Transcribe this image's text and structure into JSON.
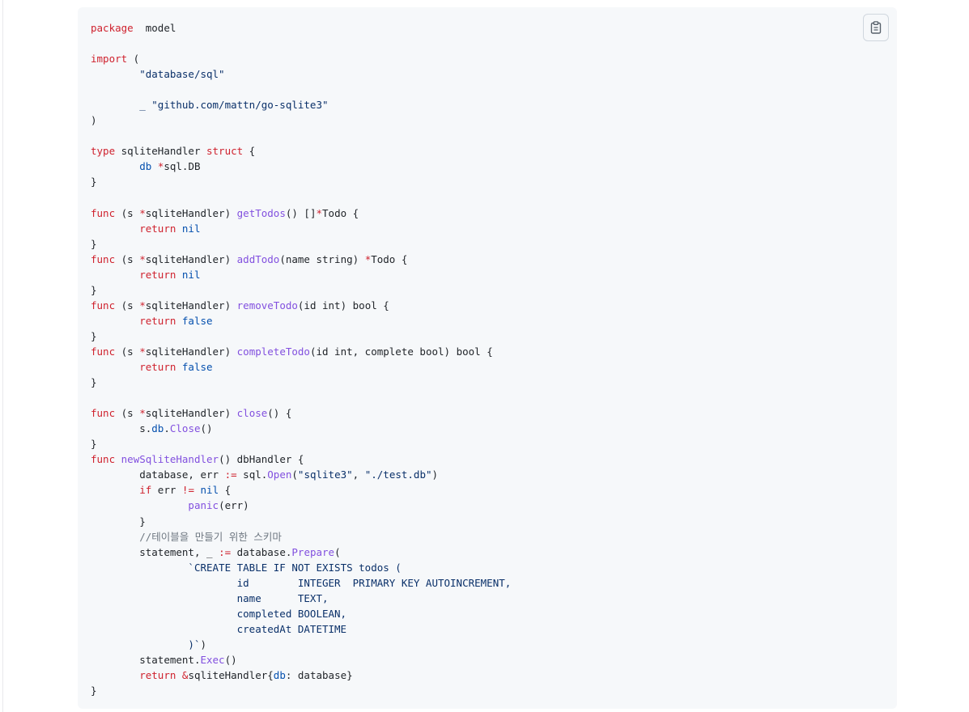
{
  "copy_button": {
    "icon": "clipboard-icon",
    "label": "Copy"
  },
  "code": {
    "language": "go",
    "lines": [
      [
        [
          "kw",
          "package"
        ],
        [
          "",
          "  model"
        ]
      ],
      [],
      [
        [
          "kw",
          "import"
        ],
        [
          "",
          " ("
        ]
      ],
      [
        [
          "st",
          "\t\"database/sql\""
        ]
      ],
      [],
      [
        [
          "st",
          "\t_ \"github.com/mattn/go-sqlite3\""
        ]
      ],
      [
        [
          "",
          ")"
        ]
      ],
      [],
      [
        [
          "kw",
          "type"
        ],
        [
          "",
          " sqliteHandler "
        ],
        [
          "kw",
          "struct"
        ],
        [
          "",
          " {"
        ]
      ],
      [
        [
          "bi",
          "\tdb"
        ],
        [
          "",
          " "
        ],
        [
          "kw",
          "*"
        ],
        [
          "",
          "sql.DB"
        ]
      ],
      [
        [
          "",
          "}"
        ]
      ],
      [],
      [
        [
          "kw",
          "func"
        ],
        [
          "",
          " (s "
        ],
        [
          "kw",
          "*"
        ],
        [
          "",
          "sqliteHandler) "
        ],
        [
          "fn",
          "getTodos"
        ],
        [
          "",
          "() []"
        ],
        [
          "kw",
          "*"
        ],
        [
          "",
          "Todo {"
        ]
      ],
      [
        [
          "kw",
          "\treturn"
        ],
        [
          "",
          " "
        ],
        [
          "bi",
          "nil"
        ]
      ],
      [
        [
          "",
          "}"
        ]
      ],
      [
        [
          "kw",
          "func"
        ],
        [
          "",
          " (s "
        ],
        [
          "kw",
          "*"
        ],
        [
          "",
          "sqliteHandler) "
        ],
        [
          "fn",
          "addTodo"
        ],
        [
          "",
          "(name string) "
        ],
        [
          "kw",
          "*"
        ],
        [
          "",
          "Todo {"
        ]
      ],
      [
        [
          "kw",
          "\treturn"
        ],
        [
          "",
          " "
        ],
        [
          "bi",
          "nil"
        ]
      ],
      [
        [
          "",
          "}"
        ]
      ],
      [
        [
          "kw",
          "func"
        ],
        [
          "",
          " (s "
        ],
        [
          "kw",
          "*"
        ],
        [
          "",
          "sqliteHandler) "
        ],
        [
          "fn",
          "removeTodo"
        ],
        [
          "",
          "(id int) bool {"
        ]
      ],
      [
        [
          "kw",
          "\treturn"
        ],
        [
          "",
          " "
        ],
        [
          "bi",
          "false"
        ]
      ],
      [
        [
          "",
          "}"
        ]
      ],
      [
        [
          "kw",
          "func"
        ],
        [
          "",
          " (s "
        ],
        [
          "kw",
          "*"
        ],
        [
          "",
          "sqliteHandler) "
        ],
        [
          "fn",
          "completeTodo"
        ],
        [
          "",
          "(id int, complete bool) bool {"
        ]
      ],
      [
        [
          "kw",
          "\treturn"
        ],
        [
          "",
          " "
        ],
        [
          "bi",
          "false"
        ]
      ],
      [
        [
          "",
          "}"
        ]
      ],
      [],
      [
        [
          "kw",
          "func"
        ],
        [
          "",
          " (s "
        ],
        [
          "kw",
          "*"
        ],
        [
          "",
          "sqliteHandler) "
        ],
        [
          "fn",
          "close"
        ],
        [
          "",
          "() {"
        ]
      ],
      [
        [
          "",
          "\ts."
        ],
        [
          "bi",
          "db"
        ],
        [
          "",
          "."
        ],
        [
          "fn",
          "Close"
        ],
        [
          "",
          "()"
        ]
      ],
      [
        [
          "",
          "}"
        ]
      ],
      [
        [
          "kw",
          "func"
        ],
        [
          "",
          " "
        ],
        [
          "fn",
          "newSqliteHandler"
        ],
        [
          "",
          "() dbHandler {"
        ]
      ],
      [
        [
          "",
          "\tdatabase, err "
        ],
        [
          "kw",
          ":="
        ],
        [
          "",
          " sql."
        ],
        [
          "fn",
          "Open"
        ],
        [
          "",
          "("
        ],
        [
          "st",
          "\"sqlite3\""
        ],
        [
          "",
          ", "
        ],
        [
          "st",
          "\"./test.db\""
        ],
        [
          "",
          ")"
        ]
      ],
      [
        [
          "kw",
          "\tif"
        ],
        [
          "",
          " err "
        ],
        [
          "kw",
          "!="
        ],
        [
          "",
          " "
        ],
        [
          "bi",
          "nil"
        ],
        [
          "",
          " {"
        ]
      ],
      [
        [
          "fn",
          "\t\tpanic"
        ],
        [
          "",
          "(err)"
        ]
      ],
      [
        [
          "",
          "\t}"
        ]
      ],
      [
        [
          "cm",
          "\t//테이블을 만들기 위한 스키마"
        ]
      ],
      [
        [
          "",
          "\tstatement, _ "
        ],
        [
          "kw",
          ":="
        ],
        [
          "",
          " database."
        ],
        [
          "fn",
          "Prepare"
        ],
        [
          "",
          "("
        ]
      ],
      [
        [
          "st",
          "\t\t`CREATE TABLE IF NOT EXISTS todos ("
        ]
      ],
      [
        [
          "st",
          "\t\t\tid        INTEGER  PRIMARY KEY AUTOINCREMENT,"
        ]
      ],
      [
        [
          "st",
          "\t\t\tname      TEXT,"
        ]
      ],
      [
        [
          "st",
          "\t\t\tcompleted BOOLEAN,"
        ]
      ],
      [
        [
          "st",
          "\t\t\tcreatedAt DATETIME"
        ]
      ],
      [
        [
          "st",
          "\t\t)`"
        ],
        [
          "",
          ")"
        ]
      ],
      [
        [
          "",
          "\tstatement."
        ],
        [
          "fn",
          "Exec"
        ],
        [
          "",
          "()"
        ]
      ],
      [
        [
          "kw",
          "\treturn"
        ],
        [
          "",
          " "
        ],
        [
          "kw",
          "&"
        ],
        [
          "",
          "sqliteHandler{"
        ],
        [
          "bi",
          "db"
        ],
        [
          "",
          ": database}"
        ]
      ],
      [
        [
          "",
          "}"
        ]
      ]
    ]
  }
}
